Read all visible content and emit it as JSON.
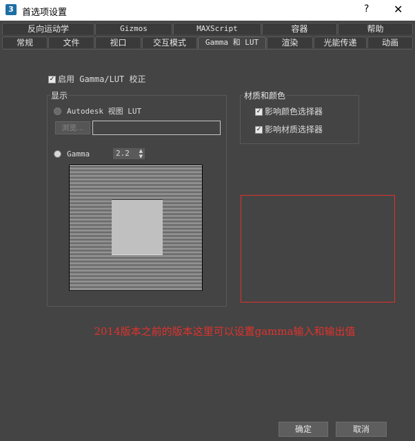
{
  "window": {
    "title": "首选项设置",
    "help": "?",
    "close": "✕",
    "app_icon": "3"
  },
  "tabs_top": [
    "反向运动学",
    "Gizmos",
    "MAXScript",
    "容器",
    "帮助"
  ],
  "tabs_bottom": [
    "常规",
    "文件",
    "视口",
    "交互模式",
    "Gamma 和 LUT",
    "渲染",
    "光能传递",
    "动画"
  ],
  "active_tab": "Gamma 和 LUT",
  "enable_gamma": {
    "label": "启用 Gamma/LUT 校正",
    "checked": true
  },
  "display": {
    "title": "显示",
    "autodesk_lut": {
      "label": "Autodesk 视图 LUT",
      "selected": false
    },
    "browse_label": "浏览...",
    "lut_path": "",
    "gamma": {
      "label": "Gamma",
      "selected": true,
      "value": "2.2"
    }
  },
  "materials": {
    "title": "材质和颜色",
    "affect_color_picker": {
      "label": "影响颜色选择器",
      "checked": true
    },
    "affect_material_editor": {
      "label": "影响材质选择器",
      "checked": true
    }
  },
  "annotation": "2014版本之前的版本这里可以设置gamma输入和输出值",
  "buttons": {
    "ok": "确定",
    "cancel": "取消"
  }
}
